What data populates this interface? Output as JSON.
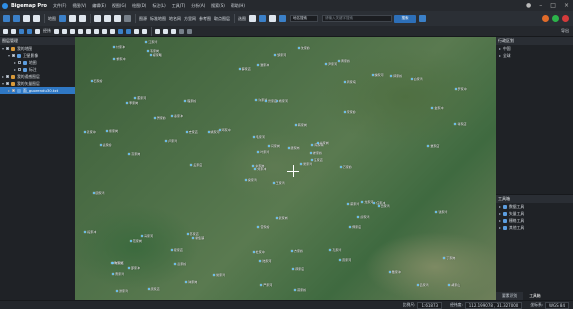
{
  "app": {
    "title": "Bigemap Pro"
  },
  "menu": [
    "文件(F)",
    "视图(V)",
    "编辑(E)",
    "视图(G)",
    "绘图(D)",
    "标注(L)",
    "工具(T)",
    "分析(A)",
    "搜索(S)",
    "帮助(H)"
  ],
  "toolbar1": {
    "labels": [
      "地图",
      "图源",
      "标准地图",
      "地名网",
      "方里网",
      "参考图",
      "取点图层",
      "选图"
    ],
    "search": {
      "placeholder": "请输入关键字搜索",
      "button": "搜索"
    },
    "combo": "地名搜索"
  },
  "toolbar2": {
    "labels": [
      "经纬",
      "导出"
    ]
  },
  "left_panel": {
    "title": "图层管理",
    "items": [
      {
        "label": "我的地图",
        "level": 0,
        "checked": true,
        "expanded": true
      },
      {
        "label": "卫星影像",
        "level": 1,
        "checked": true,
        "expanded": true
      },
      {
        "label": "地图",
        "level": 2,
        "checked": false,
        "expanded": false
      },
      {
        "label": "标注",
        "level": 2,
        "checked": false,
        "expanded": false
      },
      {
        "label": "我的遥感图层",
        "level": 0,
        "checked": true,
        "expanded": false
      },
      {
        "label": "我的矢量图层",
        "level": 0,
        "checked": true,
        "expanded": true
      },
      {
        "label": "面_guorendu30.txt",
        "level": 1,
        "checked": true,
        "expanded": false,
        "selected": true
      }
    ]
  },
  "right_top": {
    "title": "行政区划",
    "items": [
      {
        "label": "中国"
      },
      {
        "label": "全球"
      }
    ]
  },
  "right_bottom": {
    "title": "工具箱",
    "items": [
      {
        "label": "数据工具"
      },
      {
        "label": "矢量工具"
      },
      {
        "label": "栅格工具"
      },
      {
        "label": "其他工具"
      }
    ],
    "tabs": [
      "要素识别",
      "工具箱"
    ]
  },
  "statusbar": {
    "scale_label": "比例尺:",
    "scale_value": "1:61873",
    "coord_label": "经纬度:",
    "coord_value": "112.199078 , 31.327000",
    "cs_label": "坐标系:",
    "cs_value": "WGS 84"
  },
  "map": {
    "labels": [
      "王家湾",
      "李家岗",
      "刘家冲",
      "张家店",
      "陈家嘴",
      "新集镇",
      "黄家岭",
      "杨家河",
      "周家垸",
      "吴家湾",
      "郑家畈",
      "胡家山",
      "高家岗",
      "罗家冲",
      "梁家湾",
      "宋家岭",
      "唐家店",
      "许家湾",
      "韩家岗",
      "冯家河",
      "邓家冲",
      "曹家湾",
      "彭家岭",
      "曾家店",
      "肖家岗",
      "田家湾",
      "董家河",
      "潘家冲",
      "袁家岭",
      "蔡家湾",
      "蒋家店",
      "余家岗",
      "杜家冲",
      "叶家湾",
      "程家岭",
      "魏家河",
      "苏家店",
      "吕家湾",
      "丁家岗",
      "任家冲",
      "沈家岭",
      "姚家河",
      "卢家湾",
      "傅家店",
      "钟家岗",
      "姜家冲",
      "崔家岭",
      "谭家湾",
      "陆家河",
      "汪家店",
      "范家岗",
      "金家冲",
      "石家岭",
      "廖家湾",
      "贾家河",
      "夏家店",
      "韦家岗",
      "付家冲",
      "方家岭",
      "白家湾",
      "邹家河",
      "孟家店",
      "熊家岗",
      "秦家冲",
      "邱家岭",
      "江家湾",
      "尹家河",
      "薛家店",
      "闫家岗",
      "段家冲",
      "雷家岭",
      "侯家湾",
      "龙家河",
      "史家店",
      "陶家岗",
      "黎家冲",
      "贺家岭",
      "顾家湾",
      "毛家河",
      "郝家店",
      "龚家岗",
      "邵家冲",
      "万家岭",
      "钱家湾",
      "严家河",
      "覃家店",
      "武家岗",
      "戴家冲",
      "莫家岭",
      "孔家湾"
    ]
  },
  "colors": {
    "accent": "#2f78c4",
    "bg": "#1e1e1e",
    "marker": "#5ec1ff"
  }
}
